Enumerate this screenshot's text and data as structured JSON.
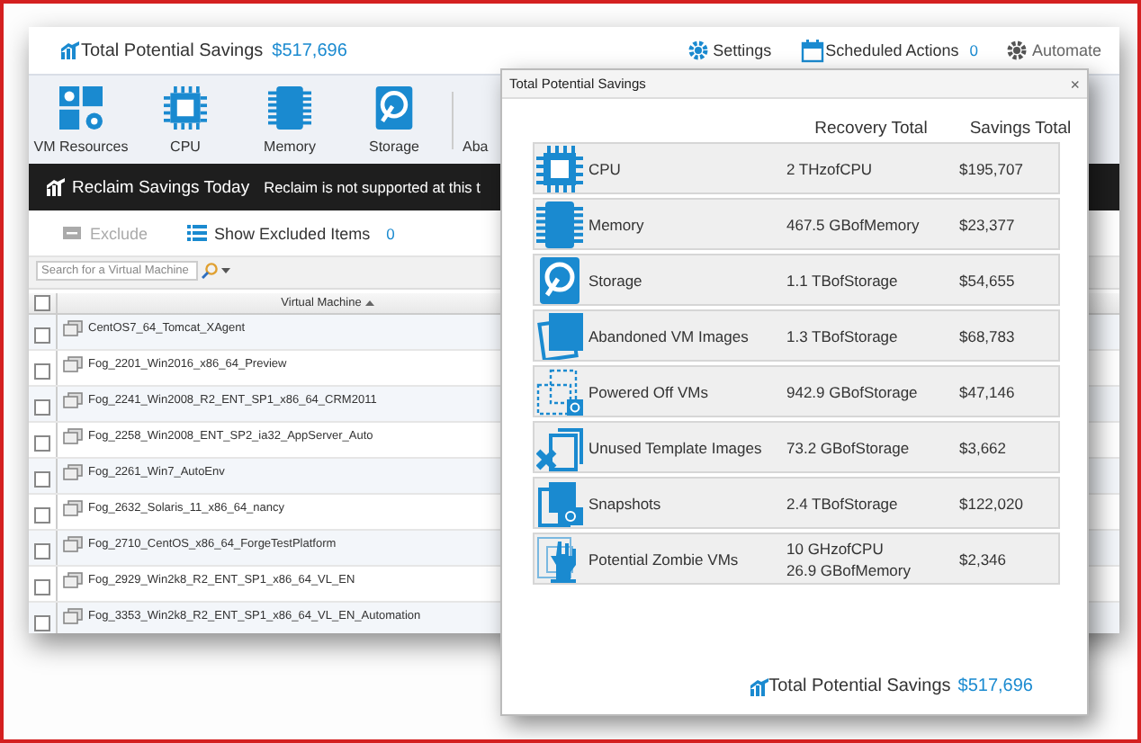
{
  "header": {
    "title": "Total Potential Savings",
    "amount": "$517,696",
    "links": [
      {
        "kind": "settings",
        "label": "Settings"
      },
      {
        "kind": "schedule",
        "label": "Scheduled Actions",
        "count": "0"
      },
      {
        "kind": "automate",
        "label": "Automate"
      }
    ]
  },
  "toolbar": [
    {
      "kind": "vm_resources",
      "label": "VM Resources"
    },
    {
      "kind": "cpu",
      "label": "CPU"
    },
    {
      "kind": "memory",
      "label": "Memory"
    },
    {
      "kind": "storage",
      "label": "Storage"
    },
    {
      "kind": "none",
      "label": "Aba"
    }
  ],
  "reclaim_bar": {
    "title": "Reclaim Savings Today",
    "message": "Reclaim is not supported at this t"
  },
  "actions": [
    {
      "kind": "exclude",
      "label": "Exclude",
      "disabled": true
    },
    {
      "kind": "show",
      "label": "Show Excluded Items",
      "count": "0",
      "disabled": false
    }
  ],
  "search": {
    "placeholder": "Search for a Virtual Machine"
  },
  "table": {
    "column": "Virtual Machine",
    "select_all": {
      "checked": false
    },
    "rows": [
      {
        "name": "CentOS7_64_Tomcat_XAgent",
        "checked": false
      },
      {
        "name": "Fog_2201_Win2016_x86_64_Preview",
        "checked": false
      },
      {
        "name": "Fog_2241_Win2008_R2_ENT_SP1_x86_64_CRM2011",
        "checked": false
      },
      {
        "name": "Fog_2258_Win2008_ENT_SP2_ia32_AppServer_Auto",
        "checked": false
      },
      {
        "name": "Fog_2261_Win7_AutoEnv",
        "checked": false
      },
      {
        "name": "Fog_2632_Solaris_11_x86_64_nancy",
        "checked": false
      },
      {
        "name": "Fog_2710_CentOS_x86_64_ForgeTestPlatform",
        "checked": false
      },
      {
        "name": "Fog_2929_Win2k8_R2_ENT_SP1_x86_64_VL_EN",
        "checked": false
      },
      {
        "name": "Fog_3353_Win2k8_R2_ENT_SP1_x86_64_VL_EN_Automation",
        "checked": false
      }
    ]
  },
  "dialog": {
    "title": "Total Potential Savings",
    "close": "×",
    "columns": [
      "Recovery Total",
      "Savings Total"
    ],
    "rows": [
      {
        "kind": "cpu",
        "name": "CPU",
        "recovery": [
          "2 THzofCPU"
        ],
        "savings": "$195,707"
      },
      {
        "kind": "memory",
        "name": "Memory",
        "recovery": [
          "467.5 GBofMemory"
        ],
        "savings": "$23,377"
      },
      {
        "kind": "storage",
        "name": "Storage",
        "recovery": [
          "1.1 TBofStorage"
        ],
        "savings": "$54,655"
      },
      {
        "kind": "abandoned",
        "name": "Abandoned VM Images",
        "recovery": [
          "1.3 TBofStorage"
        ],
        "savings": "$68,783"
      },
      {
        "kind": "powered_off",
        "name": "Powered Off VMs",
        "recovery": [
          "942.9 GBofStorage"
        ],
        "savings": "$47,146"
      },
      {
        "kind": "unused_template",
        "name": "Unused Template Images",
        "recovery": [
          "73.2 GBofStorage"
        ],
        "savings": "$3,662"
      },
      {
        "kind": "snapshots",
        "name": "Snapshots",
        "recovery": [
          "2.4 TBofStorage"
        ],
        "savings": "$122,020"
      },
      {
        "kind": "zombie",
        "name": "Potential Zombie VMs",
        "recovery": [
          "10 GHzofCPU",
          "26.9 GBofMemory"
        ],
        "savings": "$2,346"
      }
    ],
    "footer": {
      "title": "Total Potential Savings",
      "amount": "$517,696"
    }
  }
}
